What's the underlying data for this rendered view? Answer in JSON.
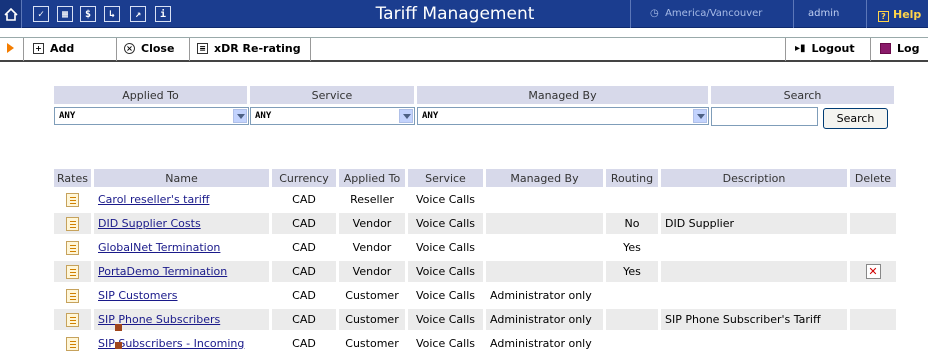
{
  "header": {
    "title": "Tariff Management",
    "timezone": "America/Vancouver",
    "user": "admin",
    "help": "Help"
  },
  "toolbar": {
    "add": "Add",
    "close": "Close",
    "rerating": "xDR Re-rating",
    "logout": "Logout",
    "log": "Log"
  },
  "filter": {
    "headers": [
      "Applied To",
      "Service",
      "Managed By",
      "Search"
    ],
    "applied_to": "ANY",
    "service": "ANY",
    "managed_by": "ANY",
    "search_value": "",
    "search_button": "Search"
  },
  "table": {
    "columns": [
      "Rates",
      "Name",
      "Currency",
      "Applied To",
      "Service",
      "Managed By",
      "Routing",
      "Description",
      "Delete"
    ],
    "rows": [
      {
        "name": "Carol reseller's tariff",
        "currency": "CAD",
        "applied_to": "Reseller",
        "service": "Voice Calls",
        "managed_by": "",
        "routing": "",
        "description": "",
        "deletable": false
      },
      {
        "name": "DID Supplier Costs",
        "currency": "CAD",
        "applied_to": "Vendor",
        "service": "Voice Calls",
        "managed_by": "",
        "routing": "No",
        "description": "DID Supplier",
        "deletable": false
      },
      {
        "name": "GlobalNet Termination",
        "currency": "CAD",
        "applied_to": "Vendor",
        "service": "Voice Calls",
        "managed_by": "",
        "routing": "Yes",
        "description": "",
        "deletable": false
      },
      {
        "name": "PortaDemo Termination",
        "currency": "CAD",
        "applied_to": "Vendor",
        "service": "Voice Calls",
        "managed_by": "",
        "routing": "Yes",
        "description": "",
        "deletable": true
      },
      {
        "name": "SIP Customers",
        "currency": "CAD",
        "applied_to": "Customer",
        "service": "Voice Calls",
        "managed_by": "Administrator only",
        "routing": "",
        "description": "",
        "deletable": false
      },
      {
        "name": "SIP Phone Subscribers",
        "currency": "CAD",
        "applied_to": "Customer",
        "service": "Voice Calls",
        "managed_by": "Administrator only",
        "routing": "",
        "description": "SIP Phone Subscriber's Tariff",
        "deletable": false
      },
      {
        "name": "SIP Subscribers - Incoming",
        "currency": "CAD",
        "applied_to": "Customer",
        "service": "Voice Calls",
        "managed_by": "Administrator only",
        "routing": "",
        "description": "",
        "deletable": false
      }
    ]
  }
}
